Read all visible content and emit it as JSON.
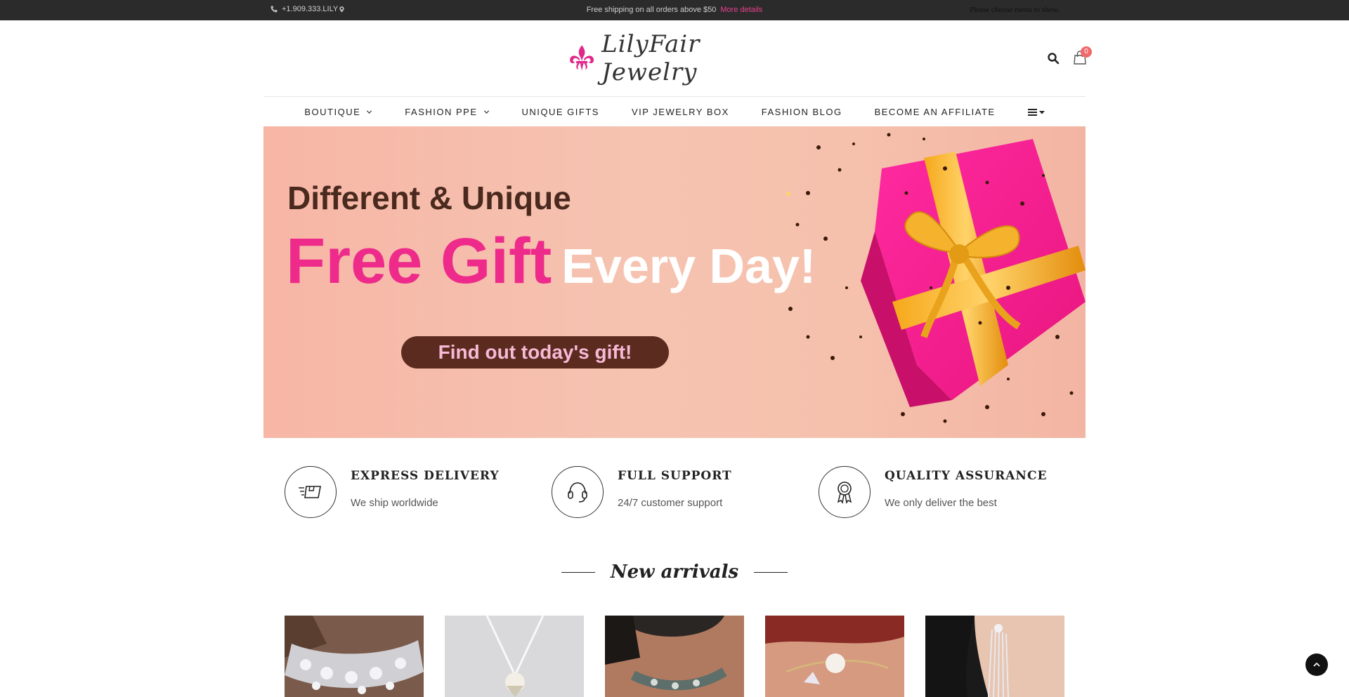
{
  "topbar": {
    "phone": "+1.909.333.LILY",
    "shipping_text": "Free shipping on all orders above $50",
    "more_details": "More details",
    "menu_note": "Please choose menu to show."
  },
  "header": {
    "logo_text": "LilyFair Jewelry",
    "cart_count": "0"
  },
  "nav": {
    "items": [
      {
        "label": "BOUTIQUE",
        "dropdown": true
      },
      {
        "label": "FASHION PPE",
        "dropdown": true
      },
      {
        "label": "UNIQUE GIFTS",
        "dropdown": false
      },
      {
        "label": "VIP JEWELRY BOX",
        "dropdown": false
      },
      {
        "label": "FASHION BLOG",
        "dropdown": false
      },
      {
        "label": "BECOME AN AFFILIATE",
        "dropdown": false
      }
    ]
  },
  "hero": {
    "line1": "Different & Unique",
    "line2_pink": "Free Gift",
    "line2_white": "Every Day!",
    "cta": "Find out today's gift!"
  },
  "features": [
    {
      "title": "EXPRESS DELIVERY",
      "desc": "We ship worldwide",
      "icon": "delivery-box-icon"
    },
    {
      "title": "FULL SUPPORT",
      "desc": "24/7 customer support",
      "icon": "headset-icon"
    },
    {
      "title": "QUALITY ASSURANCE",
      "desc": "We only deliver the best",
      "icon": "award-ribbon-icon"
    }
  ],
  "new_arrivals": {
    "title": "New arrivals",
    "products": [
      {
        "image": "crystal-choker-necklace"
      },
      {
        "image": "pearl-pendant-necklace"
      },
      {
        "image": "statement-beaded-necklace"
      },
      {
        "image": "pearl-cuff-bracelet"
      },
      {
        "image": "crystal-tassel-earrings"
      }
    ]
  },
  "colors": {
    "accent_pink": "#ee2b8b",
    "topbar_bg": "#2b2b2b",
    "hero_bg": "#f6c1b0",
    "cta_bg": "#5a2b1e"
  }
}
